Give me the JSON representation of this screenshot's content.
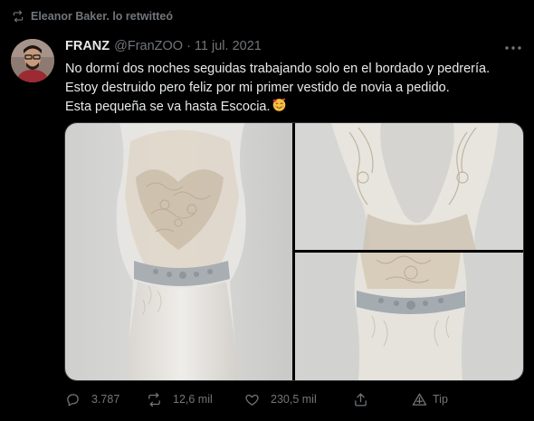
{
  "retweet_banner": {
    "text": "Eleanor Baker. lo retwitteó",
    "icon": "retweet-icon"
  },
  "tweet": {
    "author": "FRANZ",
    "handle": "@FranZOO",
    "separator": "·",
    "date": "11 jul. 2021",
    "text_lines": [
      "No dormí dos noches seguidas trabajando solo en el bordado y pedrería.",
      "Estoy destruido pero feliz por mi primer  vestido de novia a pedido.",
      "Esta pequeña se va hasta Escocia."
    ],
    "emoji": "smiling-face-with-hearts"
  },
  "media": {
    "photos": [
      "front-view-dress",
      "back-view-dress",
      "waist-detail-dress"
    ]
  },
  "actions": {
    "replies": "3.787",
    "retweets": "12,6 mil",
    "likes": "230,5 mil",
    "share_icon": "share-icon",
    "tip_label": "Tip"
  },
  "colors": {
    "background": "#000000",
    "text": "#e7e9ea",
    "secondary": "#71767b"
  }
}
